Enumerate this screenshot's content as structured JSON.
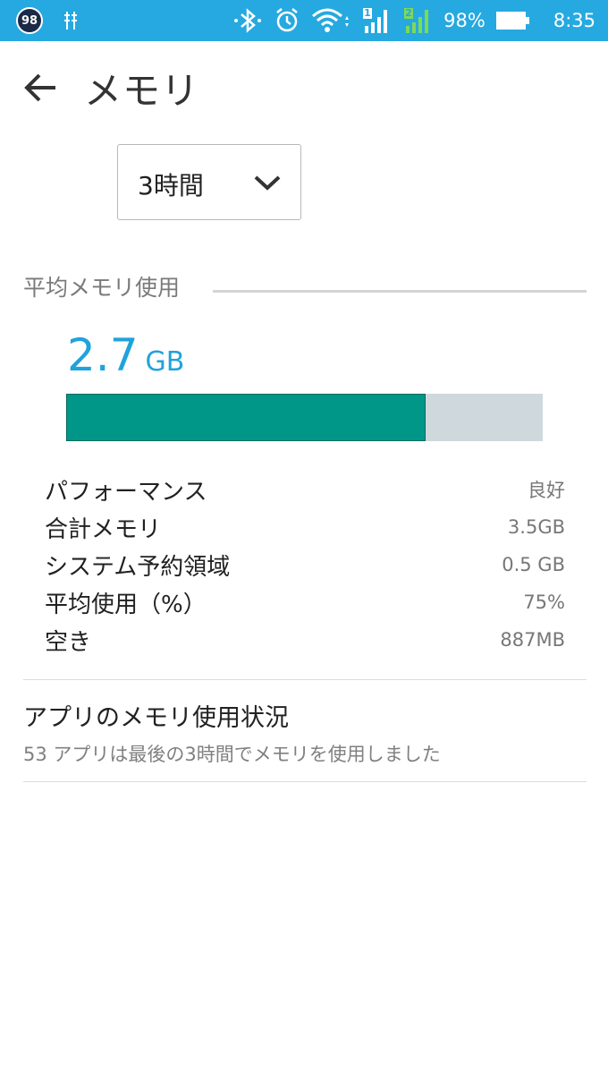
{
  "statusbar": {
    "notification_badge": "98",
    "battery": "98%",
    "time": "8:35",
    "sim1": "1",
    "sim2": "2",
    "icons": [
      "usb-debug-icon",
      "bluetooth-icon",
      "alarm-icon",
      "wifi-icon",
      "signal-icon",
      "battery-icon"
    ]
  },
  "appbar": {
    "title": "メモリ"
  },
  "dropdown": {
    "selected": "3時間"
  },
  "summary": {
    "section_title": "平均メモリ使用",
    "value": "2.7",
    "unit": "GB",
    "usage_fraction": 0.755
  },
  "details": [
    {
      "label": "パフォーマンス",
      "value": "良好"
    },
    {
      "label": "合計メモリ",
      "value": "3.5GB"
    },
    {
      "label": "システム予約領域",
      "value": "0.5 GB"
    },
    {
      "label": "平均使用（%）",
      "value": "75%"
    },
    {
      "label": "空き",
      "value": "887MB"
    }
  ],
  "apps": {
    "title": "アプリのメモリ使用状況",
    "subtitle": "53 アプリは最後の3時間でメモリを使用しました"
  },
  "colors": {
    "statusbar": "#26a9e0",
    "accent": "#1fa3dc",
    "bar_fill": "#009688",
    "bar_track": "#cfd8dc"
  }
}
